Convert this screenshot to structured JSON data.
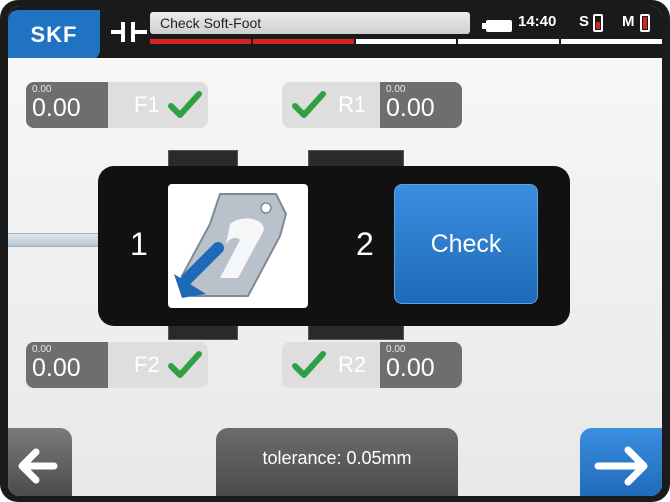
{
  "header": {
    "brand": "SKF",
    "title": "Check Soft-Foot",
    "time": "14:40",
    "s_label": "S",
    "m_label": "M",
    "progress_steps": 5,
    "progress_done": 2
  },
  "feet": {
    "f1": {
      "label": "F1",
      "small_value": "0.00",
      "value": "0.00",
      "checked": true
    },
    "r1": {
      "label": "R1",
      "small_value": "0.00",
      "value": "0.00",
      "checked": true
    },
    "f2": {
      "label": "F2",
      "small_value": "0.00",
      "value": "0.00",
      "checked": true
    },
    "r2": {
      "label": "R2",
      "small_value": "0.00",
      "value": "0.00",
      "checked": true
    }
  },
  "machine": {
    "step1": "1",
    "step2": "2",
    "check_label": "Check",
    "shim_icon": "shim-icon"
  },
  "footer": {
    "tolerance": "tolerance: 0.05mm",
    "back_icon": "arrow-left-icon",
    "next_icon": "arrow-right-icon"
  },
  "colors": {
    "brand_blue": "#1f73c2",
    "check_green": "#2fa043",
    "progress_red": "#d42424"
  }
}
